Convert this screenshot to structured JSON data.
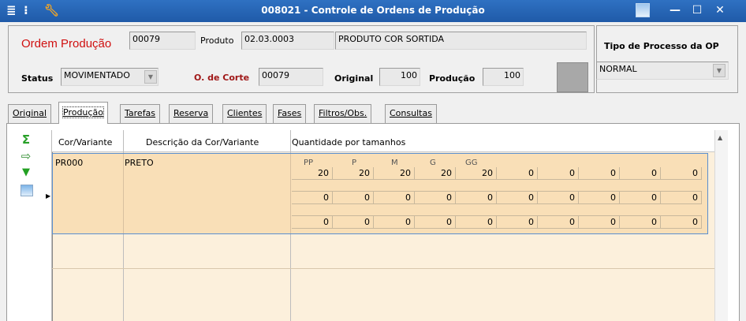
{
  "titlebar": {
    "title": "008021 - Controle de Ordens de Produção",
    "icons": [
      "menu-icon",
      "traffic-light-icon",
      "wrench-icon",
      "picture-icon"
    ],
    "controls": [
      "minimize",
      "maximize",
      "close"
    ]
  },
  "header": {
    "ordem_label": "Ordem Produção",
    "ordem_value": "00079",
    "produto_label": "Produto",
    "produto_code": "02.03.0003",
    "produto_desc": "PRODUTO COR SORTIDA",
    "tipo_label": "Tipo de Processo da OP",
    "tipo_value": "NORMAL",
    "status_label": "Status",
    "status_value": "MOVIMENTADO",
    "corte_label": "O. de Corte",
    "corte_value": "00079",
    "original_label": "Original",
    "original_value": "100",
    "producao_label": "Produção",
    "producao_value": "100"
  },
  "tabs": [
    {
      "label": "Original",
      "active": false
    },
    {
      "label": "Produção",
      "active": true
    },
    {
      "label": "Tarefas",
      "active": false
    },
    {
      "label": "Reserva",
      "active": false
    },
    {
      "label": "Clientes",
      "active": false
    },
    {
      "label": "Fases",
      "active": false
    },
    {
      "label": "Filtros/Obs.",
      "active": false
    },
    {
      "label": "Consultas",
      "active": false
    }
  ],
  "sidebar_tools": [
    "sigma-icon",
    "export-icon",
    "expand-down-icon",
    "image-icon"
  ],
  "grid": {
    "columns": [
      "Cor/Variante",
      "Descrição da Cor/Variante",
      "Quantidade por tamanhos"
    ],
    "rows": [
      {
        "cor": "PR000",
        "descricao": "PRETO",
        "sizes": [
          "PP",
          "P",
          "M",
          "G",
          "GG"
        ],
        "quantities": [
          [
            "20",
            "20",
            "20",
            "20",
            "20",
            "0",
            "0",
            "0",
            "0",
            "0"
          ],
          [
            "0",
            "0",
            "0",
            "0",
            "0",
            "0",
            "0",
            "0",
            "0",
            "0"
          ],
          [
            "0",
            "0",
            "0",
            "0",
            "0",
            "0",
            "0",
            "0",
            "0",
            "0"
          ]
        ]
      }
    ]
  },
  "colors": {
    "titlebar": "#2f71c2",
    "ordem_label": "#d01010",
    "corte_label": "#a01818",
    "grid_bg": "#fcf0dc",
    "row_selected": "#f9dfb7",
    "row_border": "#5a8fd0"
  }
}
